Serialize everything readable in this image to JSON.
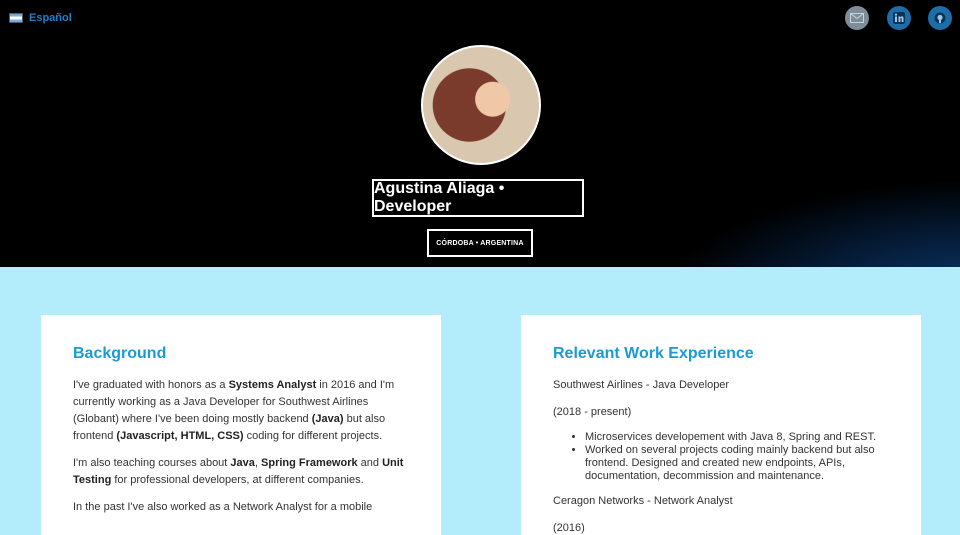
{
  "header": {
    "language_label": "Español",
    "language_flag": "argentina-flag-icon",
    "name_title": "Agustina Aliaga • Developer",
    "location": "CÓRDOBA • ARGENTINA",
    "social": [
      "mail-icon",
      "linkedin-icon",
      "github-icon"
    ]
  },
  "background": {
    "heading": "Background",
    "p1": {
      "t1": "I've graduated with honors as a ",
      "b1": "Systems Analyst",
      "t2": " in 2016 and I'm currently working as a Java Developer for Southwest Airlines (Globant) where I've been doing mostly backend ",
      "b2": "(Java)",
      "t3": " but also frontend ",
      "b3": "(Javascript, HTML, CSS)",
      "t4": " coding for different projects."
    },
    "p2": {
      "t1": "I'm also teaching courses about ",
      "b1": "Java",
      "t2": ", ",
      "b2": "Spring Framework",
      "t3": " and ",
      "b3": "Unit Testing",
      "t4": " for professional developers, at different companies."
    },
    "p3": "In the past I've also worked as a Network Analyst for a mobile"
  },
  "experience": {
    "heading": "Relevant Work Experience",
    "jobs": [
      {
        "title": "Southwest Airlines - Java Developer",
        "period": "(2018 - present)",
        "items": [
          "Microservices developement with Java 8, Spring and REST.",
          "Worked on several projects coding mainly backend but also frontend. Designed and created new endpoints, APIs, documentation, decommission and maintenance."
        ]
      },
      {
        "title": "Ceragon Networks - Network Analyst",
        "period": "(2016)"
      }
    ]
  },
  "colors": {
    "accent": "#1d9bd1",
    "content_bg": "#b3ecfb",
    "hero_bg": "#000000"
  }
}
